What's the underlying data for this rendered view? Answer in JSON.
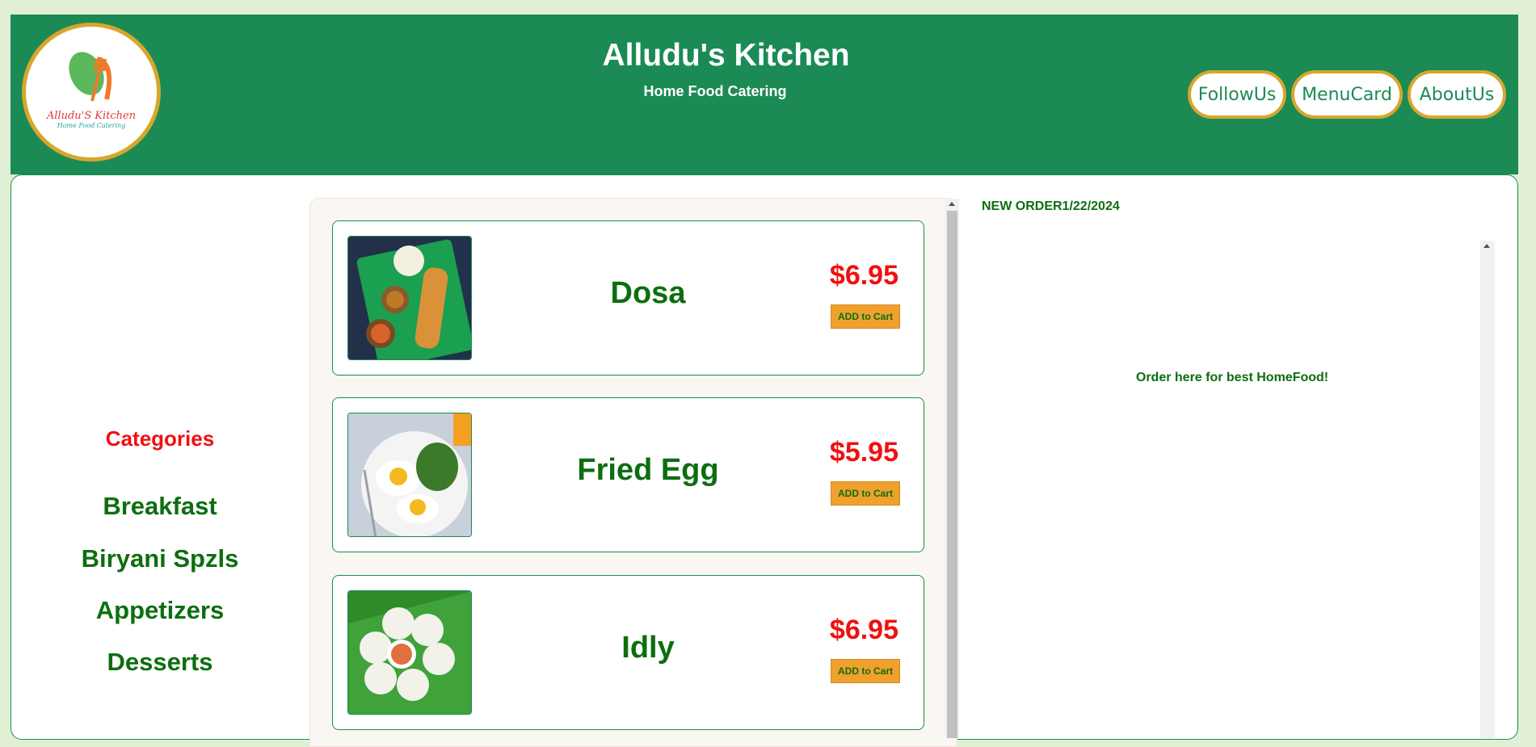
{
  "header": {
    "title": "Alludu's Kitchen",
    "subtitle": "Home Food Catering",
    "logo": {
      "name": "Alludu'S Kitchen",
      "tagline": "Home Food Catering"
    },
    "nav": [
      "FollowUs",
      "MenuCard",
      "AboutUs"
    ]
  },
  "categories": {
    "title": "Categories",
    "items": [
      "Breakfast",
      "Biryani Spzls",
      "Appetizers",
      "Desserts"
    ]
  },
  "menu": {
    "add_label": "ADD to Cart",
    "items": [
      {
        "name": "Dosa",
        "price": "$6.95",
        "image": "dosa-photo"
      },
      {
        "name": "Fried Egg",
        "price": "$5.95",
        "image": "fried-egg-photo"
      },
      {
        "name": "Idly",
        "price": "$6.95",
        "image": "idly-photo"
      }
    ]
  },
  "order": {
    "label": "NEW ORDER1/22/2024",
    "message": "Order here for best HomeFood!"
  },
  "colors": {
    "brand_green": "#1b8a55",
    "text_green": "#0d6e10",
    "price_red": "#f01010",
    "accent_gold": "#d7a72c",
    "button_orange": "#f0a02c",
    "page_bg": "#e1efd5"
  }
}
